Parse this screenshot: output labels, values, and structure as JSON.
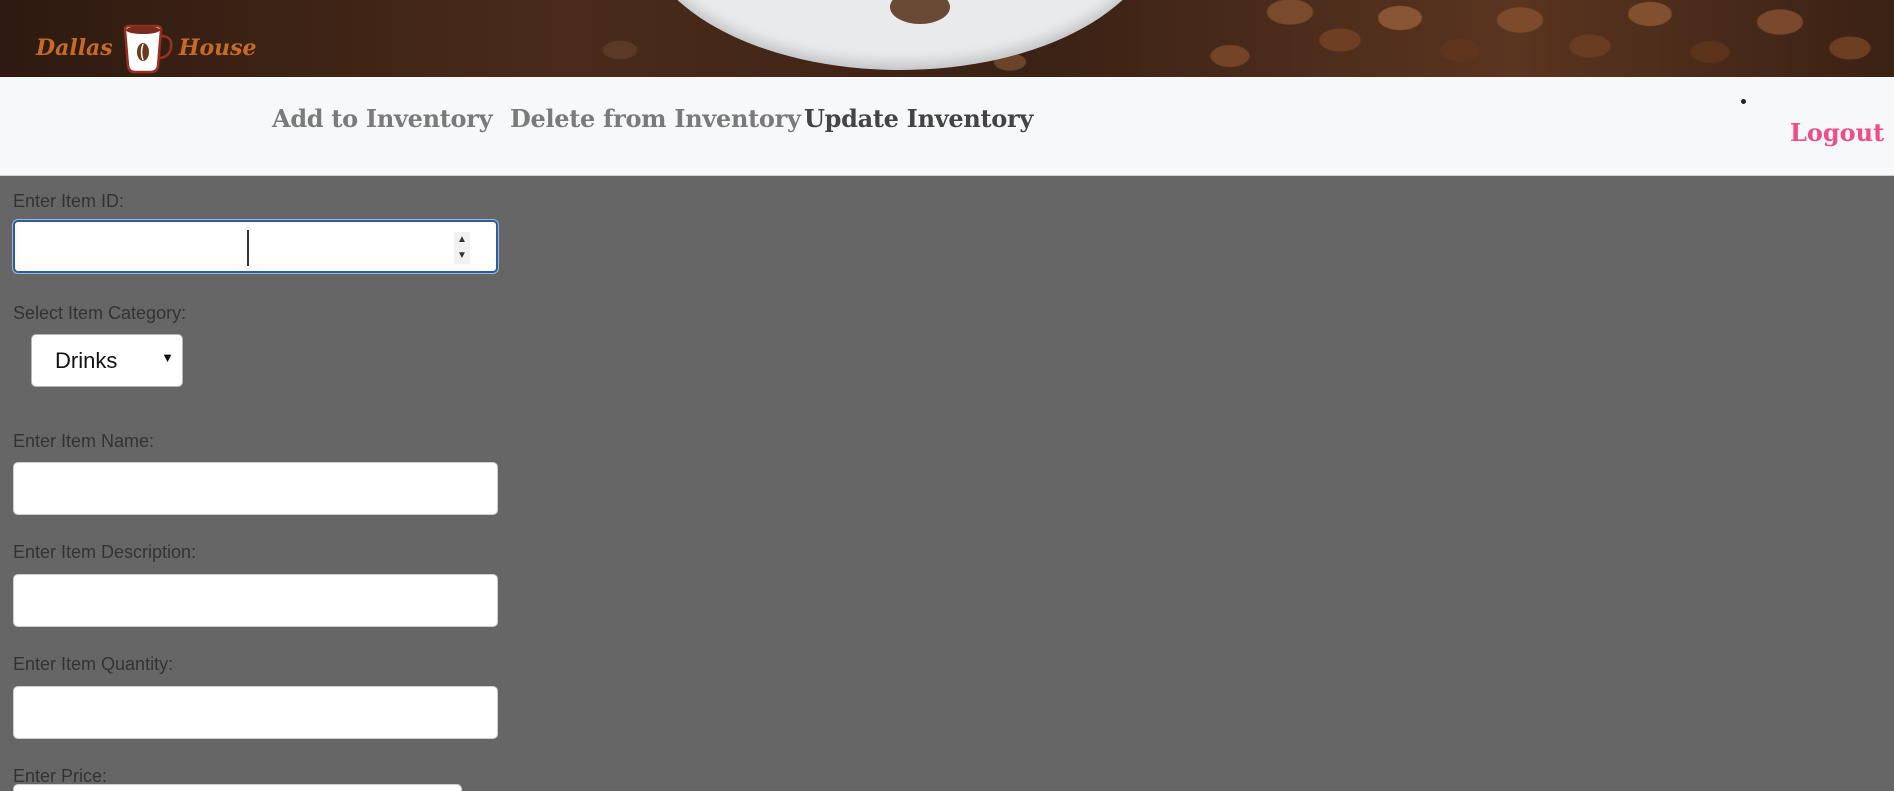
{
  "brand": {
    "left_word": "Dallas",
    "right_word": "House",
    "logo_icon": "coffee-cup-icon",
    "color": "#c66a2a"
  },
  "nav": {
    "links": [
      {
        "label": "Add to Inventory"
      },
      {
        "label": "Delete from Inventory"
      },
      {
        "label": "Update Inventory"
      }
    ],
    "logout_label": "Logout",
    "logout_color": "#ef4d86"
  },
  "form": {
    "item_id_label": "Enter Item ID:",
    "item_id_value": "",
    "category_label": "Select Item Category:",
    "category_selected": "Drinks",
    "name_label": "Enter Item Name:",
    "name_value": "",
    "description_label": "Enter Item Description:",
    "description_value": "",
    "quantity_label": "Enter Item Quantity:",
    "quantity_value": "",
    "price_label": "Enter Price:"
  }
}
